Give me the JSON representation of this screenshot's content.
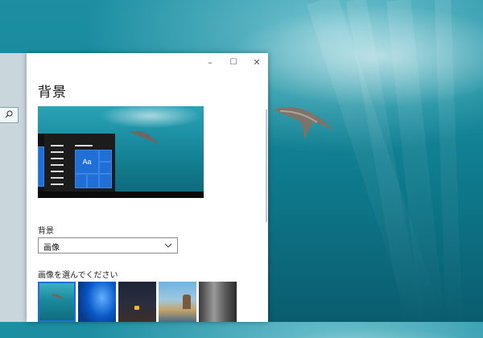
{
  "window": {
    "title": "背景",
    "controls": {
      "minimize": "–",
      "maximize": "☐",
      "close": "✕"
    }
  },
  "preview": {
    "tile_text": "Aa"
  },
  "background": {
    "label": "背景",
    "selected": "画像"
  },
  "pictures": {
    "label": "画像を選んでください",
    "items": [
      "underwater",
      "windows-blue",
      "night-tent",
      "coast-rocks",
      "grey-tunnel"
    ],
    "selected_index": 0
  },
  "colors": {
    "accent": "#1f6fd6",
    "wallpaper": "#168a9c"
  }
}
